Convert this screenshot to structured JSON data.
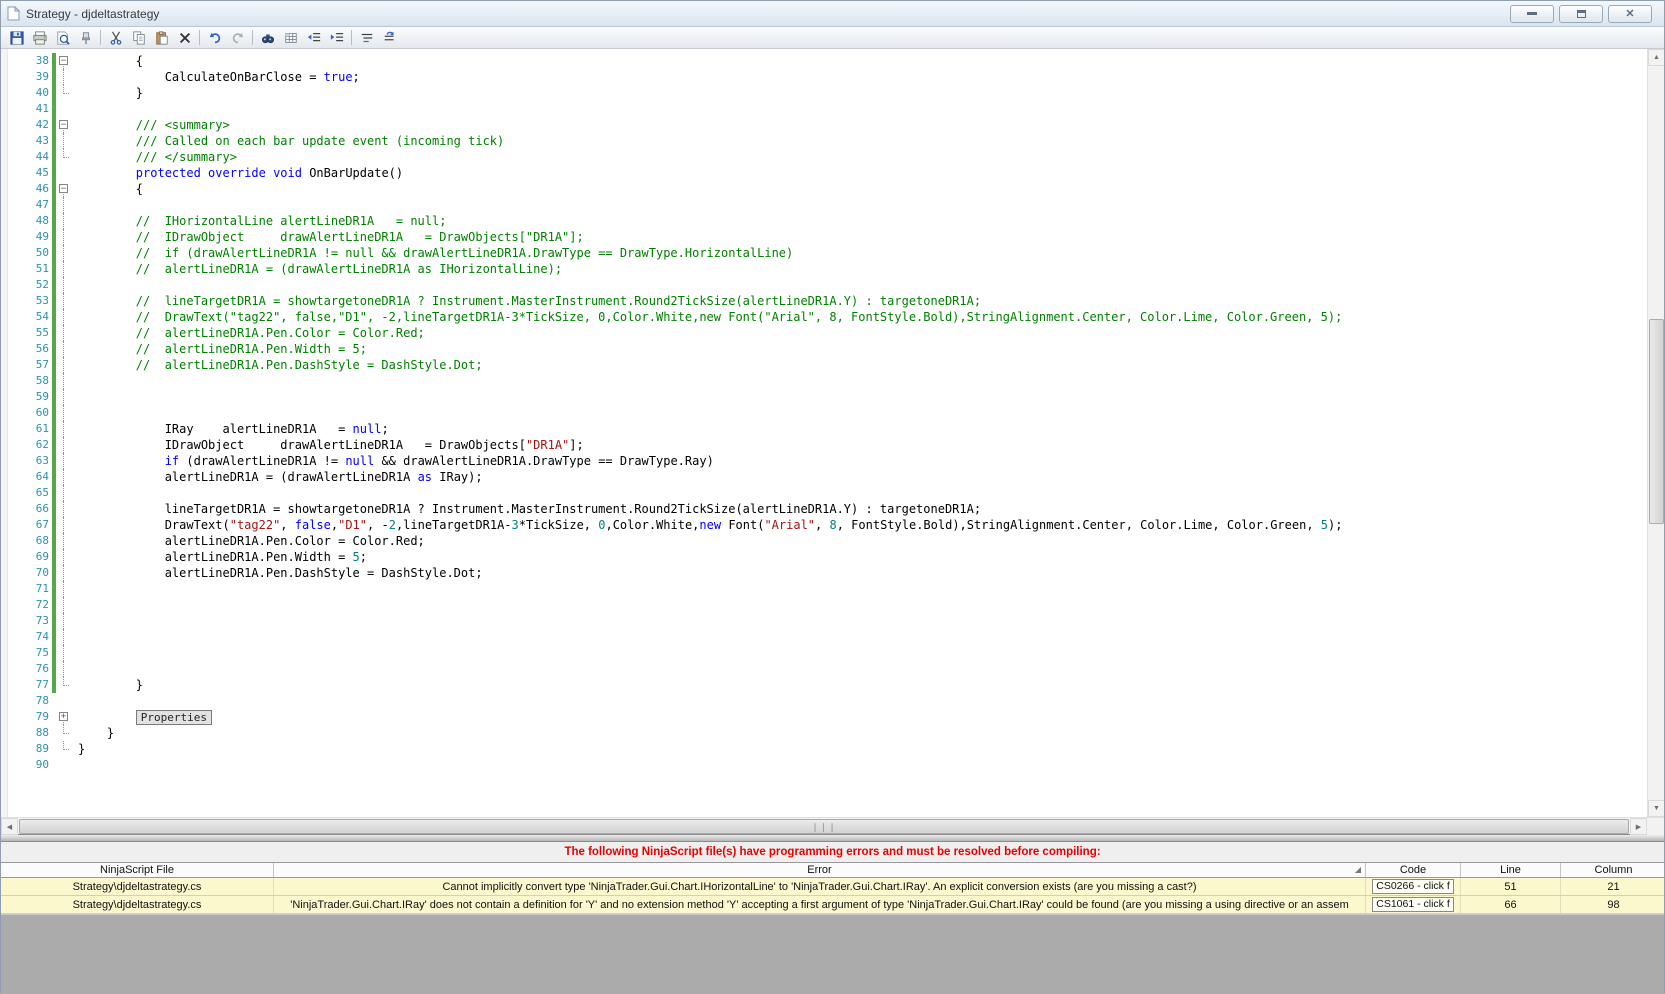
{
  "window": {
    "title": "Strategy - djdeltastrategy",
    "buttons": [
      "minimize",
      "restore",
      "close"
    ]
  },
  "toolbar": {
    "icons": [
      "save",
      "print",
      "print-preview",
      "pin",
      "cut",
      "copy",
      "paste",
      "delete",
      "undo",
      "redo",
      "find",
      "grid",
      "outdent",
      "indent",
      "comment",
      "uncomment"
    ]
  },
  "editor": {
    "colors": {
      "keyword": "#0000FF",
      "comment": "#008000",
      "string": "#A31515",
      "number": "#008080",
      "line_number": "#2B91AF",
      "change_bar": "#57A64A"
    },
    "collapsed_region_label": "Properties",
    "lines": [
      {
        "n": 38,
        "chg": 1,
        "fold": "m",
        "seg": [
          [
            "        {",
            "d"
          ]
        ]
      },
      {
        "n": 39,
        "chg": 1,
        "fold": "v",
        "seg": [
          [
            "            CalculateOnBarClose = ",
            "d"
          ],
          [
            "true",
            "k"
          ],
          [
            ";",
            "d"
          ]
        ]
      },
      {
        "n": 40,
        "chg": 1,
        "fold": "e",
        "seg": [
          [
            "        }",
            "d"
          ]
        ]
      },
      {
        "n": 41,
        "chg": 1,
        "fold": "",
        "seg": []
      },
      {
        "n": 42,
        "chg": 1,
        "fold": "m",
        "seg": [
          [
            "        /// <summary>",
            "c"
          ]
        ]
      },
      {
        "n": 43,
        "chg": 1,
        "fold": "v",
        "seg": [
          [
            "        /// Called on each bar update event (incoming tick)",
            "c"
          ]
        ]
      },
      {
        "n": 44,
        "chg": 1,
        "fold": "e",
        "seg": [
          [
            "        /// </summary>",
            "c"
          ]
        ]
      },
      {
        "n": 45,
        "chg": 1,
        "fold": "",
        "seg": [
          [
            "        ",
            "d"
          ],
          [
            "protected override void",
            "k"
          ],
          [
            " OnBarUpdate()",
            "d"
          ]
        ]
      },
      {
        "n": 46,
        "chg": 1,
        "fold": "m",
        "seg": [
          [
            "        {",
            "d"
          ]
        ]
      },
      {
        "n": 47,
        "chg": 1,
        "fold": "v",
        "seg": []
      },
      {
        "n": 48,
        "chg": 1,
        "fold": "v",
        "seg": [
          [
            "        //  IHorizontalLine alertLineDR1A   = null;",
            "c"
          ]
        ]
      },
      {
        "n": 49,
        "chg": 1,
        "fold": "v",
        "seg": [
          [
            "        //  IDrawObject     drawAlertLineDR1A   = DrawObjects[\"DR1A\"];",
            "c"
          ]
        ]
      },
      {
        "n": 50,
        "chg": 1,
        "fold": "v",
        "seg": [
          [
            "        //  if (drawAlertLineDR1A != null && drawAlertLineDR1A.DrawType == DrawType.HorizontalLine)",
            "c"
          ]
        ]
      },
      {
        "n": 51,
        "chg": 1,
        "fold": "v",
        "seg": [
          [
            "        //  alertLineDR1A = (drawAlertLineDR1A as IHorizontalLine);",
            "c"
          ]
        ]
      },
      {
        "n": 52,
        "chg": 1,
        "fold": "v",
        "seg": []
      },
      {
        "n": 53,
        "chg": 1,
        "fold": "v",
        "seg": [
          [
            "        //  lineTargetDR1A = showtargetoneDR1A ? Instrument.MasterInstrument.Round2TickSize(alertLineDR1A.Y) : targetoneDR1A;",
            "c"
          ]
        ]
      },
      {
        "n": 54,
        "chg": 1,
        "fold": "v",
        "seg": [
          [
            "        //  DrawText(\"tag22\", false,\"D1\", -2,lineTargetDR1A-3*TickSize, 0,Color.White,new Font(\"Arial\", 8, FontStyle.Bold),StringAlignment.Center, Color.Lime, Color.Green, 5);",
            "c"
          ]
        ]
      },
      {
        "n": 55,
        "chg": 1,
        "fold": "v",
        "seg": [
          [
            "        //  alertLineDR1A.Pen.Color = Color.Red;",
            "c"
          ]
        ]
      },
      {
        "n": 56,
        "chg": 1,
        "fold": "v",
        "seg": [
          [
            "        //  alertLineDR1A.Pen.Width = 5;",
            "c"
          ]
        ]
      },
      {
        "n": 57,
        "chg": 1,
        "fold": "v",
        "seg": [
          [
            "        //  alertLineDR1A.Pen.DashStyle = DashStyle.Dot;",
            "c"
          ]
        ]
      },
      {
        "n": 58,
        "chg": 1,
        "fold": "v",
        "seg": []
      },
      {
        "n": 59,
        "chg": 1,
        "fold": "v",
        "seg": []
      },
      {
        "n": 60,
        "chg": 1,
        "fold": "v",
        "seg": []
      },
      {
        "n": 61,
        "chg": 1,
        "fold": "v",
        "seg": [
          [
            "            IRay    alertLineDR1A   = ",
            "d"
          ],
          [
            "null",
            "k"
          ],
          [
            ";",
            "d"
          ]
        ]
      },
      {
        "n": 62,
        "chg": 1,
        "fold": "v",
        "seg": [
          [
            "            IDrawObject     drawAlertLineDR1A   = DrawObjects[",
            "d"
          ],
          [
            "\"DR1A\"",
            "s"
          ],
          [
            "];",
            "d"
          ]
        ]
      },
      {
        "n": 63,
        "chg": 1,
        "fold": "v",
        "seg": [
          [
            "            ",
            "d"
          ],
          [
            "if",
            "k"
          ],
          [
            " (drawAlertLineDR1A != ",
            "d"
          ],
          [
            "null",
            "k"
          ],
          [
            " && drawAlertLineDR1A.DrawType == DrawType.Ray)",
            "d"
          ]
        ]
      },
      {
        "n": 64,
        "chg": 1,
        "fold": "v",
        "seg": [
          [
            "            alertLineDR1A = (drawAlertLineDR1A ",
            "d"
          ],
          [
            "as",
            "k"
          ],
          [
            " IRay);",
            "d"
          ]
        ]
      },
      {
        "n": 65,
        "chg": 1,
        "fold": "v",
        "seg": []
      },
      {
        "n": 66,
        "chg": 1,
        "fold": "v",
        "seg": [
          [
            "            lineTargetDR1A = showtargetoneDR1A ? Instrument.MasterInstrument.Round2TickSize(alertLineDR1A.Y) : targetoneDR1A;",
            "d"
          ]
        ]
      },
      {
        "n": 67,
        "chg": 1,
        "fold": "v",
        "seg": [
          [
            "            DrawText(",
            "d"
          ],
          [
            "\"tag22\"",
            "s"
          ],
          [
            ", ",
            "d"
          ],
          [
            "false",
            "k"
          ],
          [
            ",",
            "d"
          ],
          [
            "\"D1\"",
            "s"
          ],
          [
            ", -",
            "d"
          ],
          [
            "2",
            "n"
          ],
          [
            ",lineTargetDR1A-",
            "d"
          ],
          [
            "3",
            "n"
          ],
          [
            "*TickSize, ",
            "d"
          ],
          [
            "0",
            "n"
          ],
          [
            ",Color.White,",
            "d"
          ],
          [
            "new",
            "k"
          ],
          [
            " Font(",
            "d"
          ],
          [
            "\"Arial\"",
            "s"
          ],
          [
            ", ",
            "d"
          ],
          [
            "8",
            "n"
          ],
          [
            ", FontStyle.Bold),StringAlignment.Center, Color.Lime, Color.Green, ",
            "d"
          ],
          [
            "5",
            "n"
          ],
          [
            ");",
            "d"
          ]
        ]
      },
      {
        "n": 68,
        "chg": 1,
        "fold": "v",
        "seg": [
          [
            "            alertLineDR1A.Pen.Color = Color.Red;",
            "d"
          ]
        ]
      },
      {
        "n": 69,
        "chg": 1,
        "fold": "v",
        "seg": [
          [
            "            alertLineDR1A.Pen.Width = ",
            "d"
          ],
          [
            "5",
            "n"
          ],
          [
            ";",
            "d"
          ]
        ]
      },
      {
        "n": 70,
        "chg": 1,
        "fold": "v",
        "seg": [
          [
            "            alertLineDR1A.Pen.DashStyle = DashStyle.Dot;",
            "d"
          ]
        ]
      },
      {
        "n": 71,
        "chg": 1,
        "fold": "v",
        "seg": []
      },
      {
        "n": 72,
        "chg": 1,
        "fold": "v",
        "seg": []
      },
      {
        "n": 73,
        "chg": 1,
        "fold": "v",
        "seg": []
      },
      {
        "n": 74,
        "chg": 1,
        "fold": "v",
        "seg": []
      },
      {
        "n": 75,
        "chg": 1,
        "fold": "v",
        "seg": []
      },
      {
        "n": 76,
        "chg": 1,
        "fold": "v",
        "seg": []
      },
      {
        "n": 77,
        "chg": 1,
        "fold": "e",
        "seg": [
          [
            "        }",
            "d"
          ]
        ]
      },
      {
        "n": 78,
        "chg": 0,
        "fold": "",
        "seg": []
      },
      {
        "n": 79,
        "chg": 0,
        "fold": "p",
        "seg": [
          [
            "        ",
            "d"
          ],
          [
            "Properties",
            "box"
          ]
        ]
      },
      {
        "n": 88,
        "chg": 0,
        "fold": "e",
        "seg": [
          [
            "    }",
            "d"
          ]
        ]
      },
      {
        "n": 89,
        "chg": 0,
        "fold": "e",
        "seg": [
          [
            "}",
            "d"
          ]
        ]
      },
      {
        "n": 90,
        "chg": 0,
        "fold": "",
        "seg": []
      }
    ]
  },
  "error_panel": {
    "banner": "The following NinjaScript file(s) have programming errors and must be resolved before compiling:",
    "columns": [
      "NinjaScript File",
      "Error",
      "Code",
      "Line",
      "Column"
    ],
    "rows": [
      {
        "file": "Strategy\\djdeltastrategy.cs",
        "error": "Cannot implicitly convert type 'NinjaTrader.Gui.Chart.IHorizontalLine' to 'NinjaTrader.Gui.Chart.IRay'. An explicit conversion exists (are you missing a cast?)",
        "code": "CS0266 - click f",
        "line": "51",
        "column": "21"
      },
      {
        "file": "Strategy\\djdeltastrategy.cs",
        "error": "'NinjaTrader.Gui.Chart.IRay' does not contain a definition for 'Y' and no extension method 'Y' accepting a first argument of type 'NinjaTrader.Gui.Chart.IRay' could be found (are you missing a using directive or an assem",
        "code": "CS1061 - click f",
        "line": "66",
        "column": "98"
      }
    ]
  }
}
